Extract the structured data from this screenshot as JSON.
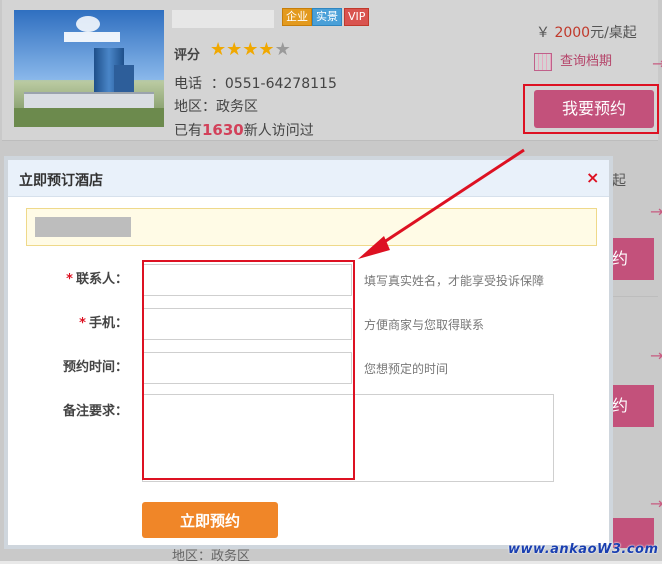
{
  "listing": {
    "badges": [
      "企业",
      "实景",
      "VIP"
    ],
    "rating_label": "评分",
    "rating_stars": 4,
    "rating_max": 5,
    "phone_label": "电话",
    "phone": "0551-64278115",
    "area_label": "地区：",
    "area": "政务区",
    "visits_prefix": "已有",
    "visits_count": "1630",
    "visits_suffix": "新人访问过",
    "price_symbol": "￥",
    "price_value": "2000",
    "price_unit": "元/桌起",
    "schedule_link": "查询档期",
    "book_button": "我要预约",
    "side_price_unit": "起",
    "side_book": "约",
    "bottom_area": "地区：政务区"
  },
  "modal": {
    "title": "立即预订酒店",
    "close": "×",
    "form": {
      "contact_label": "联系人：",
      "contact_hint": "填写真实姓名，才能享受投诉保障",
      "phone_label": "手机：",
      "phone_hint": "方便商家与您取得联系",
      "time_label": "预约时间：",
      "time_hint": "您想预定的时间",
      "remark_label": "备注要求：",
      "submit": "立即预约",
      "required_mark": "*"
    }
  },
  "watermark": "www.ankaoW3.com",
  "colors": {
    "accent_pink": "#c3517b",
    "submit_orange": "#f08628",
    "highlight_red": "#dd1122",
    "visit_count": "#d2415a"
  }
}
